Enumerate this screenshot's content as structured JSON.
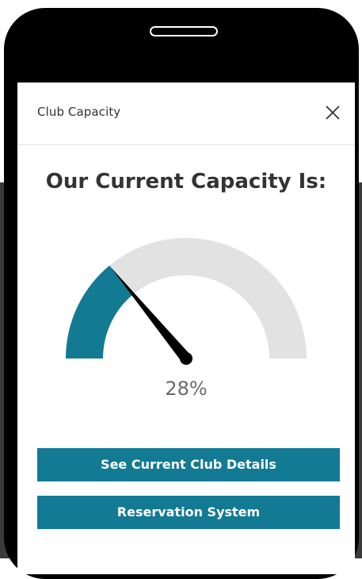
{
  "modal": {
    "title": "Club Capacity",
    "heading": "Our Current Capacity Is:"
  },
  "gauge": {
    "value": 28,
    "max": 100,
    "label": "28%",
    "fill_color": "#137a94",
    "track_color": "#e2e2e2",
    "needle_color": "#000000"
  },
  "buttons": {
    "details_label": "See Current Club Details",
    "reservation_label": "Reservation System"
  },
  "icons": {
    "close": "close-x-icon"
  }
}
